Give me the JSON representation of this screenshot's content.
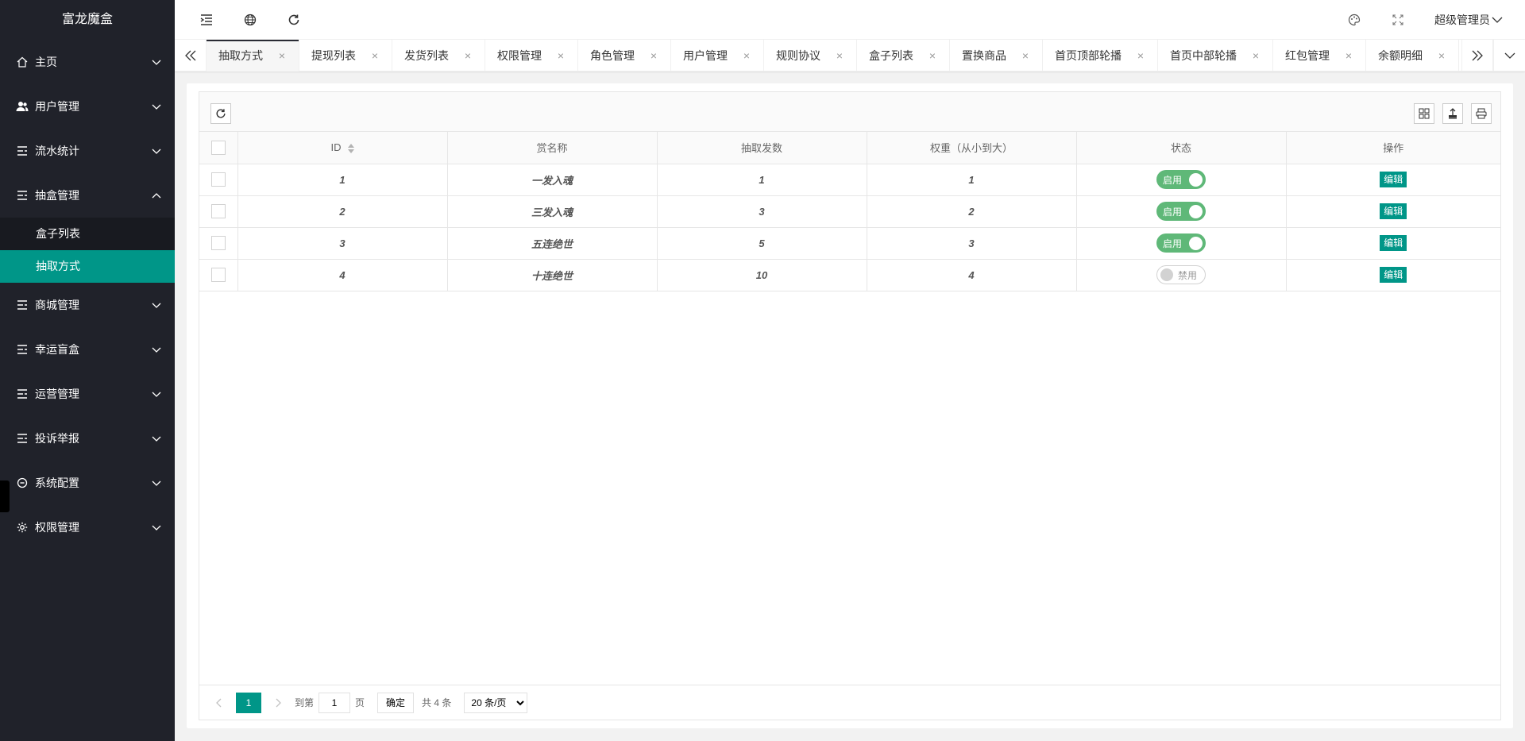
{
  "app": {
    "title": "富龙魔盒"
  },
  "sidebar": {
    "items": [
      {
        "label": "主页",
        "icon": "home-icon"
      },
      {
        "label": "用户管理",
        "icon": "users-icon"
      },
      {
        "label": "流水统计",
        "icon": "list-icon"
      },
      {
        "label": "抽盒管理",
        "icon": "list-icon",
        "expanded": true,
        "children": [
          {
            "label": "盒子列表"
          },
          {
            "label": "抽取方式",
            "active": true
          }
        ]
      },
      {
        "label": "商城管理",
        "icon": "list-icon"
      },
      {
        "label": "幸运盲盒",
        "icon": "list-icon"
      },
      {
        "label": "运营管理",
        "icon": "list-icon"
      },
      {
        "label": "投诉举报",
        "icon": "list-icon"
      },
      {
        "label": "系统配置",
        "icon": "config-icon"
      },
      {
        "label": "权限管理",
        "icon": "gear-icon"
      }
    ]
  },
  "header": {
    "user": "超级管理员"
  },
  "tabs": [
    {
      "label": "抽取方式",
      "active": true
    },
    {
      "label": "提现列表"
    },
    {
      "label": "发货列表"
    },
    {
      "label": "权限管理"
    },
    {
      "label": "角色管理"
    },
    {
      "label": "用户管理"
    },
    {
      "label": "规则协议"
    },
    {
      "label": "盒子列表"
    },
    {
      "label": "置换商品"
    },
    {
      "label": "首页顶部轮播"
    },
    {
      "label": "首页中部轮播"
    },
    {
      "label": "红包管理"
    },
    {
      "label": "余额明细"
    }
  ],
  "table": {
    "columns": [
      "ID",
      "赏名称",
      "抽取发数",
      "权重（从小到大）",
      "状态",
      "操作"
    ],
    "rows": [
      {
        "id": "1",
        "name": "一发入魂",
        "count": "1",
        "weight": "1",
        "status": "启用",
        "on": true,
        "action": "编辑"
      },
      {
        "id": "2",
        "name": "三发入魂",
        "count": "3",
        "weight": "2",
        "status": "启用",
        "on": true,
        "action": "编辑"
      },
      {
        "id": "3",
        "name": "五连绝世",
        "count": "5",
        "weight": "3",
        "status": "启用",
        "on": true,
        "action": "编辑"
      },
      {
        "id": "4",
        "name": "十连绝世",
        "count": "10",
        "weight": "4",
        "status": "禁用",
        "on": false,
        "action": "编辑"
      }
    ]
  },
  "pager": {
    "current": "1",
    "goto_label": "到第",
    "goto_value": "1",
    "page_label": "页",
    "confirm": "确定",
    "total": "共 4 条",
    "per_page": "20 条/页"
  },
  "colors": {
    "accent": "#009688",
    "switch_on": "#5FB878",
    "sidebar_bg": "#20222a"
  }
}
